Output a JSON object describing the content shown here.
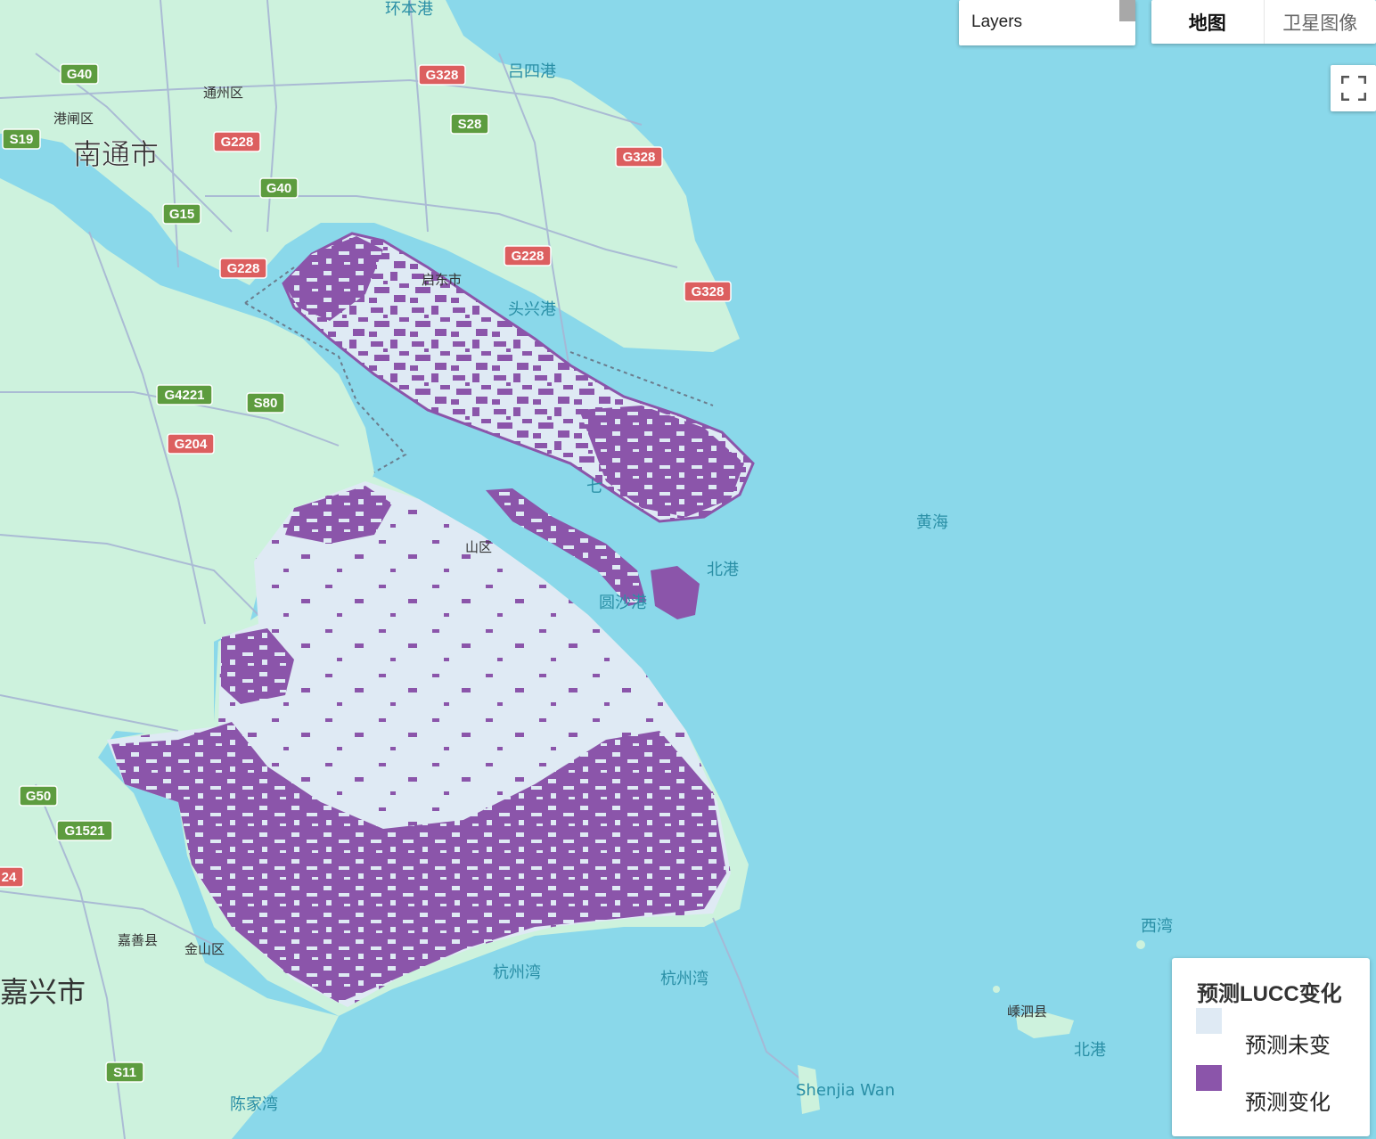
{
  "map": {
    "labels": {
      "huanbengang": "环本港",
      "tongzhou": "通州区",
      "lvsigang": "吕四港",
      "nantong": "南通市",
      "gangzha": "港闸区",
      "qidong": "启东市",
      "touxinggang": "头兴港",
      "huanghai": "黄海",
      "qi": "七",
      "shan": "山区",
      "beigang1": "北港",
      "yuansha": "圆沙港",
      "hangzhouwan1": "杭州湾",
      "hangzhouwan2": "杭州湾",
      "jiashan": "嘉善县",
      "jinshan": "金山区",
      "jiaxing": "嘉兴市",
      "xiwan": "西湾",
      "shengsi": "嵊泗县",
      "beigang2": "北港",
      "shenjiawan": "Shenjia Wan",
      "chenjiawan": "陈家湾"
    },
    "shields": {
      "g40a": "G40",
      "g328a": "G328",
      "s28": "S28",
      "s19": "S19",
      "g228a": "G228",
      "g40b": "G40",
      "g328b": "G328",
      "g15": "G15",
      "g228b": "G228",
      "g228c": "G228",
      "g328c": "G328",
      "g4221": "G4221",
      "s80": "S80",
      "g204": "G204",
      "g50": "G50",
      "g1521": "G1521",
      "s11": "S11",
      "edge24": "24"
    },
    "colors": {
      "water": "#8ad8ea",
      "land": "#cdf2dd",
      "prediction_unchanged": "#dfeaf4",
      "prediction_changed": "#8b55aa",
      "shield_national": "#dc5f5f",
      "shield_expressway": "#5d9c3f"
    }
  },
  "controls": {
    "layers_label": "Layers",
    "map_type": {
      "map": "地图",
      "satellite": "卫星图像"
    },
    "fullscreen_icon": "fullscreen-icon"
  },
  "legend": {
    "title": "预测LUCC变化",
    "items": [
      {
        "label": "预测未变",
        "color": "#dfeaf4"
      },
      {
        "label": "预测变化",
        "color": "#8b55aa"
      }
    ]
  }
}
